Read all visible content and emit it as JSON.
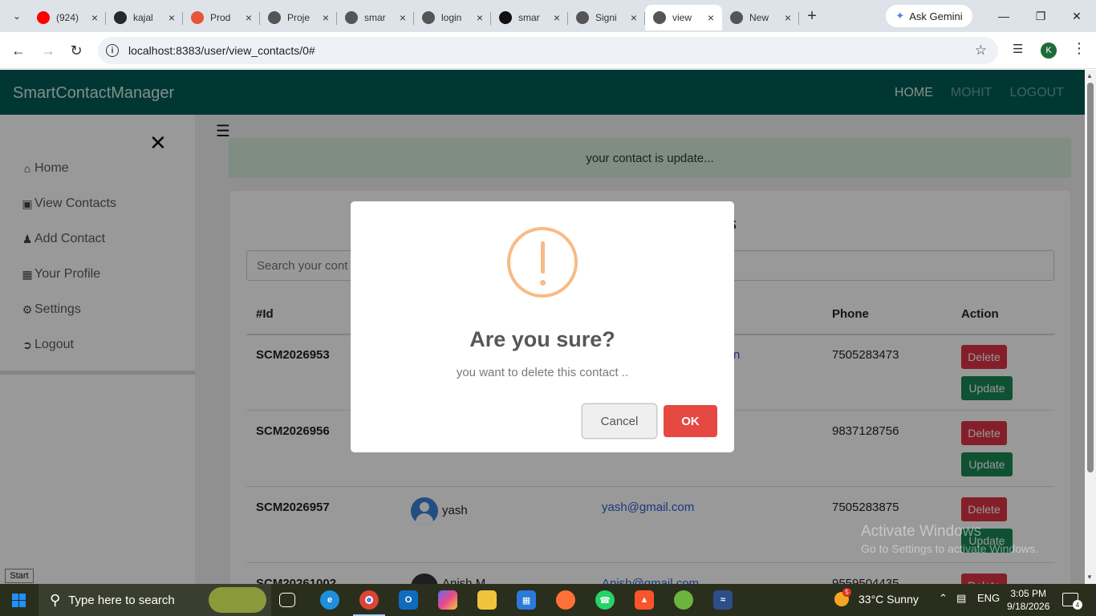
{
  "browser": {
    "tabs": [
      {
        "title": "(924)",
        "icon": "youtube-icon",
        "color": "#ff0000"
      },
      {
        "title": "kajal",
        "icon": "github-icon",
        "color": "#24292e"
      },
      {
        "title": "Prod",
        "icon": "producthunt-icon",
        "color": "#e8543a"
      },
      {
        "title": "Proje",
        "icon": "openai-icon",
        "color": "#555555"
      },
      {
        "title": "smar",
        "icon": "globe-icon",
        "color": "#555555"
      },
      {
        "title": "login",
        "icon": "globe-icon",
        "color": "#555555"
      },
      {
        "title": "smar",
        "icon": "openai-icon",
        "color": "#111111"
      },
      {
        "title": "Signi",
        "icon": "globe-icon",
        "color": "#555555"
      },
      {
        "title": "view",
        "icon": "globe-icon",
        "color": "#555555",
        "active": true
      },
      {
        "title": "New",
        "icon": "chrome-icon",
        "color": "#555555"
      }
    ],
    "ask_gemini": "Ask Gemini",
    "url": "localhost:8383/user/view_contacts/0#",
    "profile_initial": "K"
  },
  "app": {
    "brand": "SmartContactManager",
    "nav": {
      "home": "HOME",
      "user": "MOHIT",
      "logout": "LOGOUT"
    },
    "sidebar": [
      {
        "label": "Home",
        "icon": "home-icon"
      },
      {
        "label": "View Contacts",
        "icon": "contacts-icon"
      },
      {
        "label": "Add Contact",
        "icon": "add-user-icon"
      },
      {
        "label": "Your Profile",
        "icon": "profile-icon"
      },
      {
        "label": "Settings",
        "icon": "settings-icon"
      },
      {
        "label": "Logout",
        "icon": "logout-icon"
      }
    ],
    "alert": "your contact is update...",
    "card_title_fragment": "s",
    "search_placeholder": "Search your cont",
    "table": {
      "headers": {
        "id": "#Id",
        "phone": "Phone",
        "action": "Action"
      },
      "rows": [
        {
          "id": "SCM2026953",
          "name": "",
          "email": "n",
          "phone": "7505283473"
        },
        {
          "id": "SCM2026956",
          "name": "",
          "email": "",
          "phone": "9837128756"
        },
        {
          "id": "SCM2026957",
          "name": "yash",
          "email": "yash@gmail.com",
          "phone": "7505283875"
        },
        {
          "id": "SCM20261002",
          "name": "Anish M",
          "email": "Anish@gmail.com",
          "phone": "9559504435"
        }
      ],
      "delete_label": "Delete",
      "update_label": "Update"
    }
  },
  "modal": {
    "title": "Are you sure?",
    "text": "you want to delete this contact ..",
    "cancel": "Cancel",
    "ok": "OK",
    "accent": "#f8bb86",
    "ok_color": "#e64942"
  },
  "watermark": {
    "line1": "Activate Windows",
    "line2": "Go to Settings to activate Windows."
  },
  "tooltip": "Start",
  "taskbar": {
    "search_placeholder": "Type here to search",
    "weather": "33°C  Sunny",
    "weather_badge": "5",
    "language": "ENG",
    "time": "3:05 PM",
    "date": "9/18/2026",
    "notifications": "4"
  }
}
